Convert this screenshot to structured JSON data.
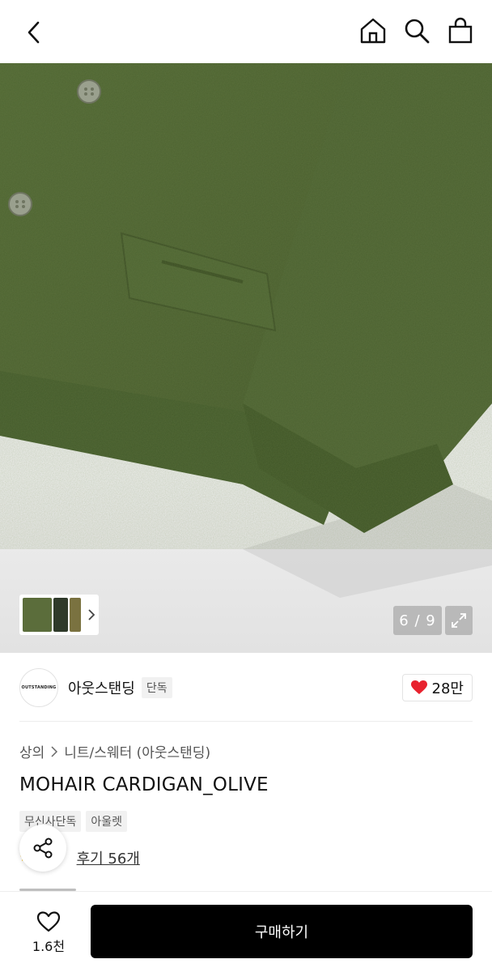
{
  "nav": {
    "back_icon": "chevron-left-icon",
    "icons": [
      "home-icon",
      "search-icon",
      "shopping-bag-icon"
    ]
  },
  "gallery": {
    "counter": "6 / 9",
    "zoom_icon": "expand-icon"
  },
  "brand": {
    "logo_text": "OUTSTANDING",
    "name": "아웃스탠딩",
    "badge": "단독",
    "likes": "28만"
  },
  "product": {
    "breadcrumb": [
      "상의",
      "니트/스웨터 (아웃스탠딩)"
    ],
    "title": "MOHAIR CARDIGAN_OLIVE",
    "tags": [
      "무신사단독",
      "아울렛"
    ],
    "reviews": "후기 56개"
  },
  "bottom": {
    "wish_count": "1.6천",
    "buy_label": "구매하기"
  },
  "colors": {
    "olive": "#556b2f",
    "heart": "#e8222e",
    "buy_bg": "#000000"
  }
}
